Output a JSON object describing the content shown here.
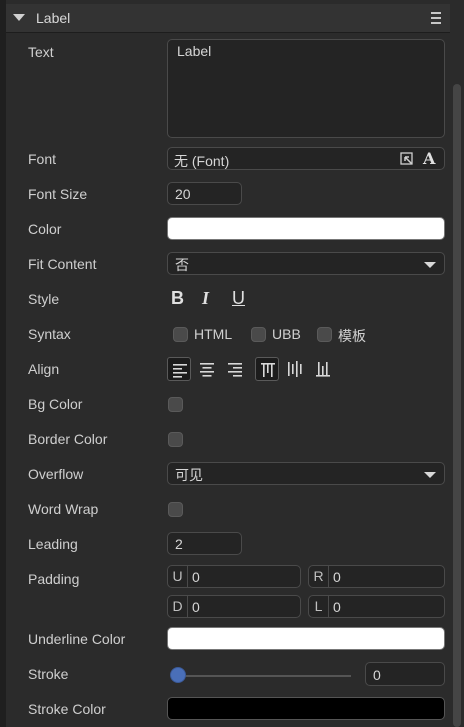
{
  "panel": {
    "title": "Label"
  },
  "fields": {
    "text": {
      "label": "Text",
      "value": "Label"
    },
    "font": {
      "label": "Font",
      "value": "无 (Font)"
    },
    "font_size": {
      "label": "Font Size",
      "value": "20"
    },
    "color": {
      "label": "Color",
      "value": "#ffffff"
    },
    "fit_content": {
      "label": "Fit Content",
      "value": "否"
    },
    "style": {
      "label": "Style",
      "bold": "B",
      "italic": "I",
      "underline": "U"
    },
    "syntax": {
      "label": "Syntax",
      "options": [
        "HTML",
        "UBB",
        "模板"
      ]
    },
    "align": {
      "label": "Align"
    },
    "bg_color": {
      "label": "Bg Color"
    },
    "border_color": {
      "label": "Border Color"
    },
    "overflow": {
      "label": "Overflow",
      "value": "可见"
    },
    "word_wrap": {
      "label": "Word Wrap"
    },
    "leading": {
      "label": "Leading",
      "value": "2"
    },
    "padding": {
      "label": "Padding",
      "up": {
        "prefix": "U",
        "value": "0"
      },
      "right": {
        "prefix": "R",
        "value": "0"
      },
      "down": {
        "prefix": "D",
        "value": "0"
      },
      "left": {
        "prefix": "L",
        "value": "0"
      }
    },
    "underline_color": {
      "label": "Underline Color",
      "value": "#ffffff"
    },
    "stroke": {
      "label": "Stroke",
      "value": "0"
    },
    "stroke_color": {
      "label": "Stroke Color",
      "value": "#000000"
    }
  },
  "icons": {
    "collapse": "triangle-down-icon",
    "menu": "hamburger-menu-icon",
    "font_picker": "picker-icon",
    "font_style": "font-a-icon"
  },
  "colors": {
    "background": "#2b2b2b",
    "accent": "#4a6fb8"
  }
}
